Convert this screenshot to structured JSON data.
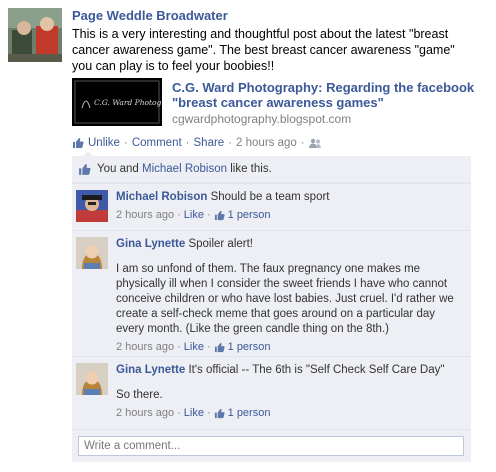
{
  "post": {
    "author": "Page Weddle Broadwater",
    "message": "This is a very interesting and thoughtful post about the latest \"breast cancer awareness game\". The best breast cancer awareness \"game\" you can play is to feel your boobies!!",
    "attachment": {
      "title": "C.G. Ward Photography: Regarding the facebook \"breast cancer awareness games\"",
      "url": "cgwardphotography.blogspot.com",
      "thumb_caption": "C.G. Ward Photography"
    },
    "actions": {
      "unlike": "Unlike",
      "comment": "Comment",
      "share": "Share",
      "time": "2 hours ago",
      "separator": "·"
    }
  },
  "likes": {
    "you": "You and",
    "other": "Michael Robison",
    "suffix": "like this."
  },
  "comments": [
    {
      "name": "Michael Robison",
      "text": "Should be a team sport",
      "time": "2 hours ago",
      "like_label": "Like",
      "like_count": "1 person"
    },
    {
      "name": "Gina Lynette",
      "text": "Spoiler alert!",
      "para": "I am so unfond of them. The faux pregnancy one makes me physically ill when I consider the sweet friends I have who cannot conceive children or who have lost babies. Just cruel. I'd rather we create a self-check meme that goes around on a particular day every month. (Like the green candle thing on the 8th.)",
      "time": "2 hours ago",
      "like_label": "Like",
      "like_count": "1 person"
    },
    {
      "name": "Gina Lynette",
      "text": "It's official -- The 6th is \"Self Check Self Care Day\"",
      "para": "So there.",
      "time": "2 hours ago",
      "like_label": "Like",
      "like_count": "1 person"
    }
  ],
  "composer": {
    "placeholder": "Write a comment..."
  },
  "colors": {
    "link": "#3b5998",
    "ufi_bg": "#edeff4",
    "meta": "#808080"
  }
}
